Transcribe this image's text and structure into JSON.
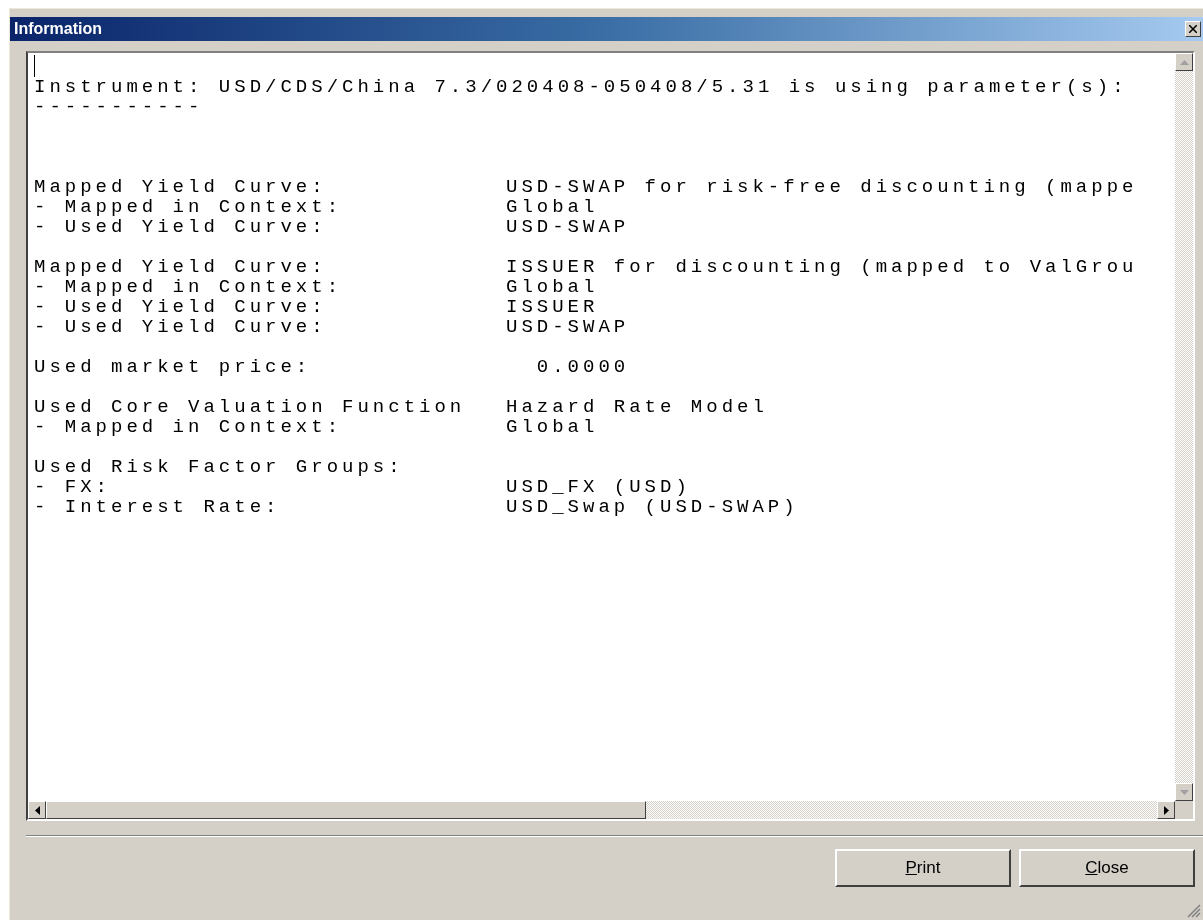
{
  "window": {
    "title": "Information"
  },
  "text_area": {
    "header": "Instrument: USD/CDS/China 7.3/020408-050408/5.31 is using parameter(s):",
    "rule": "-----------",
    "groups": [
      {
        "lines": [
          {
            "label": "Mapped Yield Curve:",
            "value": "USD-SWAP for risk-free discounting (mappe"
          },
          {
            "label": "- Mapped in Context:",
            "value": "Global"
          },
          {
            "label": "- Used Yield Curve:",
            "value": "USD-SWAP"
          }
        ]
      },
      {
        "lines": [
          {
            "label": "Mapped Yield Curve:",
            "value": "ISSUER for discounting (mapped to ValGrou"
          },
          {
            "label": "- Mapped in Context:",
            "value": "Global"
          },
          {
            "label": "- Used Yield Curve:",
            "value": "ISSUER"
          },
          {
            "label": "- Used Yield Curve:",
            "value": "USD-SWAP"
          }
        ]
      },
      {
        "lines": [
          {
            "label": "Used market price:",
            "value": "  0.0000"
          }
        ]
      },
      {
        "lines": [
          {
            "label": "Used Core Valuation Function",
            "value": "Hazard Rate Model"
          },
          {
            "label": "- Mapped in Context:",
            "value": "Global"
          }
        ]
      },
      {
        "lines": [
          {
            "label": "Used Risk Factor Groups:"
          },
          {
            "label": "- FX:",
            "value": "USD_FX (USD)"
          },
          {
            "label": "- Interest Rate:",
            "value": "USD_Swap (USD-SWAP)"
          }
        ]
      }
    ]
  },
  "buttons": [
    {
      "label": "Print",
      "mnemonic_first": true
    },
    {
      "label": "Close",
      "mnemonic_first": true
    }
  ]
}
